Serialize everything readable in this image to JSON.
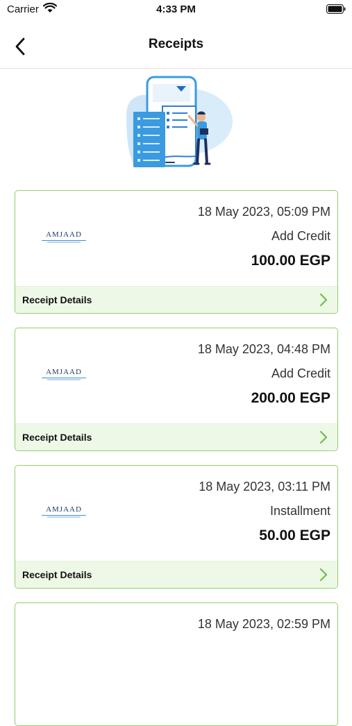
{
  "status_bar": {
    "carrier": "Carrier",
    "time": "4:33 PM"
  },
  "nav": {
    "title": "Receipts"
  },
  "receipts": [
    {
      "date": "18 May 2023, 05:09 PM",
      "type": "Add Credit",
      "amount": "100.00 EGP",
      "details_label": "Receipt Details",
      "logo_text": "AMJAAD"
    },
    {
      "date": "18 May 2023, 04:48 PM",
      "type": "Add Credit",
      "amount": "200.00 EGP",
      "details_label": "Receipt Details",
      "logo_text": "AMJAAD"
    },
    {
      "date": "18 May 2023, 03:11 PM",
      "type": "Installment",
      "amount": "50.00 EGP",
      "details_label": "Receipt Details",
      "logo_text": "AMJAAD"
    },
    {
      "date": "18 May 2023, 02:59 PM"
    }
  ],
  "colors": {
    "accent": "#6cc04a",
    "card_border": "#8fd16b",
    "details_background": "#eef8e7"
  }
}
